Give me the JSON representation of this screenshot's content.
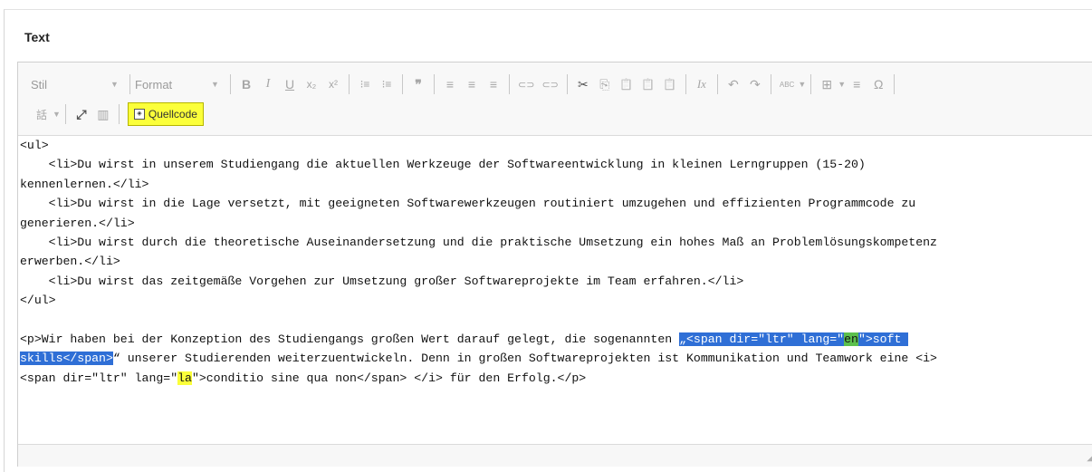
{
  "field": {
    "label": "Text"
  },
  "toolbar": {
    "style_combo": "Stil",
    "format_combo": "Format",
    "source_button": "Quellcode",
    "buttons": {
      "bold": "B",
      "italic": "I",
      "underline": "U",
      "subscript": "x₂",
      "superscript": "x²",
      "numbered_list": "⁝≡",
      "bullet_list": "⁝≡",
      "blockquote": "❞",
      "align_left": "≡",
      "align_center": "≡",
      "align_right": "≡",
      "link": "⊂⊃",
      "unlink": "⊂⊃",
      "cut": "✂",
      "copy": "⎘",
      "paste": "📋",
      "paste_text": "📋",
      "paste_word": "📋",
      "remove_format": "Ix",
      "undo": "↶",
      "redo": "↷",
      "spellcheck": "ABC",
      "table": "⊞",
      "horizontal_rule": "≡",
      "special_char": "Ω",
      "language": "話",
      "maximize": "⤢",
      "show_blocks": "▥"
    }
  },
  "source": {
    "lines": [
      "<ul>",
      "    <li>Du wirst in unserem Studiengang die aktuellen Werkzeuge der Softwareentwicklung in kleinen Lerngruppen (15-20)",
      "kennenlernen.</li>",
      "    <li>Du wirst in die Lage versetzt, mit geeigneten Softwarewerkzeugen routiniert umzugehen und effizienten Programmcode zu",
      "generieren.</li>",
      "    <li>Du wirst durch die theoretische Auseinandersetzung und die praktische Umsetzung ein hohes Maß an Problemlösungskompetenz",
      "erwerben.</li>",
      "    <li>Du wirst das zeitgemäße Vorgehen zur Umsetzung großer Softwareprojekte im Team erfahren.</li>",
      "</ul>",
      "",
      "<p>Wir haben bei der Konzeption des Studiengangs großen Wert darauf gelegt, die sogenannten "
    ],
    "p_sel_1": "„<span dir=\"ltr\" lang=\"",
    "p_en": "en",
    "p_sel_2": "\">soft ",
    "p_sel_3": "skills</span>",
    "p_after_1": "“ unserer Studierenden weiterzuentwickeln. Denn in großen Softwareprojekten ist Kommunikation und Teamwork eine <i>",
    "p_line3_a": "<span dir=\"ltr\" lang=\"",
    "p_la": "la",
    "p_line3_b": "\">conditio sine qua non</span> </i> für den Erfolg.</p>"
  },
  "colors": {
    "selection": "#2f6fd6",
    "highlight_yellow": "#fbff3a",
    "highlight_green": "#5cc04d"
  }
}
